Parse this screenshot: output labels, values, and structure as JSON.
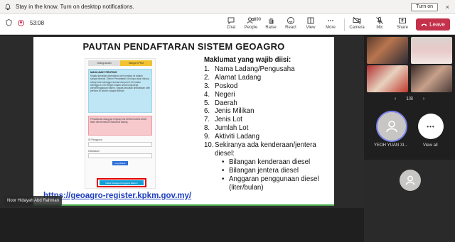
{
  "notification": {
    "message": "Stay in the know. Turn on desktop notifications.",
    "button": "Turn on",
    "close": "×"
  },
  "toolbar": {
    "timer": "53:08",
    "chat": "Chat",
    "people": "People",
    "people_count": "890",
    "raise": "Raise",
    "react": "React",
    "view": "View",
    "more": "More",
    "camera": "Camera",
    "mic": "Mic",
    "share": "Share",
    "leave": "Leave"
  },
  "slide": {
    "title": "PAUTAN PENDAFTARAN SISTEM GEOAGRO",
    "form": {
      "tab1": "Orang Awam",
      "tab2": "Warga KPKM",
      "info_heading": "MAKLUMAT PENTING",
      "info_text": "Segala kesulitan disebabkan oleh perkara ini adalah sangat dikesali. Sistem Pendaftaran GeoAgro akan ditutup setiap Isnin sehingga Jumaat dari jam 9.00 malam sehingga 12.00 tengah malam untuk kerja-kerja penyelenggaraan sistem. Segala kesulitan disebabkan oleh perkara ini adalah sangat dikesali.",
      "warn_text": "Pendaftaran dianggap lengkap bila SEMUA MAKLUMAT telah diisi termasuk maklumat ladang.",
      "user_label": "ID Pengguna",
      "pass_label": "Katalaluan",
      "login": "Log Masuk",
      "register": "Daftar Sebagai Pengguna Baharu"
    },
    "url": "https://geoagro-register.kpkm.gov.my/",
    "heading": "Maklumat yang wajib diisi:",
    "items": [
      {
        "n": "1.",
        "text": "Nama Ladang/Pengusaha"
      },
      {
        "n": "2.",
        "text": "Alamat Ladang"
      },
      {
        "n": "3.",
        "text": "Poskod"
      },
      {
        "n": "4.",
        "text": "Negeri"
      },
      {
        "n": "5.",
        "text": "Daerah"
      },
      {
        "n": "6.",
        "text": "Jenis Milikan"
      },
      {
        "n": "7.",
        "text": "Jenis Lot"
      },
      {
        "n": "8.",
        "text": "Jumlah Lot"
      },
      {
        "n": "9.",
        "text": "Aktiviti Ladang"
      },
      {
        "n": "10.",
        "text": "Sekiranya ada kenderaan/jentera"
      }
    ],
    "item10_cont": "diesel:",
    "subitems": [
      {
        "b": "•",
        "text": "Bilangan kenderaan diesel"
      },
      {
        "b": "•",
        "text": "Bilangan jentera diesel"
      },
      {
        "b": "•",
        "text": "Anggaran penggunaan diesel"
      }
    ],
    "sub3_cont": "(liter/bulan)"
  },
  "presenter_name": "Noor Hidayah Abd Rahman",
  "side": {
    "pager": "1/8",
    "prev": "‹",
    "next": "›",
    "participant_name": "YEOH YUAN XI...",
    "view_all": "View all",
    "more_glyph": "•••"
  },
  "colors": {
    "leave_red": "#c4314b",
    "accent_yellow": "#f2c230",
    "info_blue": "#bfe6f5",
    "url_blue": "#1f3fbf"
  }
}
